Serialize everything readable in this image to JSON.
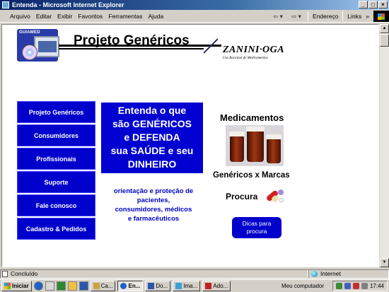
{
  "window": {
    "title": "Entenda - Microsoft Internet Explorer",
    "controls": [
      "_",
      "□",
      "×"
    ]
  },
  "menu": [
    "Arquivo",
    "Editar",
    "Exibir",
    "Favoritos",
    "Ferramentas",
    "Ajuda"
  ],
  "toolbar": {
    "address_label": "Endereço",
    "links_label": "Links"
  },
  "page": {
    "logo_text": "GUIAMED",
    "title": "Projeto Genéricos",
    "brand": "ZANINI·OGA",
    "brand_sub": "Uso Racional de Medicamentos",
    "nav": [
      "Projeto Genéricos",
      "Consumidores",
      "Profissionais",
      "Suporte",
      "Fale conosco",
      "Cadastro & Pedidos"
    ],
    "promo": [
      "Entenda o que",
      "são GENÉRICOS",
      "e DEFENDA",
      "sua SAÚDE e seu",
      "DINHEIRO"
    ],
    "orientation": [
      "orientação e proteção de",
      "pacientes,",
      "consumidores, médicos",
      "e farmacêuticos"
    ],
    "medicamentos": "Medicamentos",
    "genericos_marcas": "Genéricos x Marcas",
    "procura": "Procura",
    "dicas": [
      "Dicas para",
      "procura"
    ]
  },
  "status": {
    "left": "Concluído",
    "zone": "Internet"
  },
  "taskbar": {
    "start": "Iniciar",
    "tasks": [
      "Ca...",
      "En...",
      "Do...",
      "Ima...",
      "Ado..."
    ],
    "active_task": "En...",
    "my_computer": "Meu computador",
    "clock": "17:44"
  }
}
